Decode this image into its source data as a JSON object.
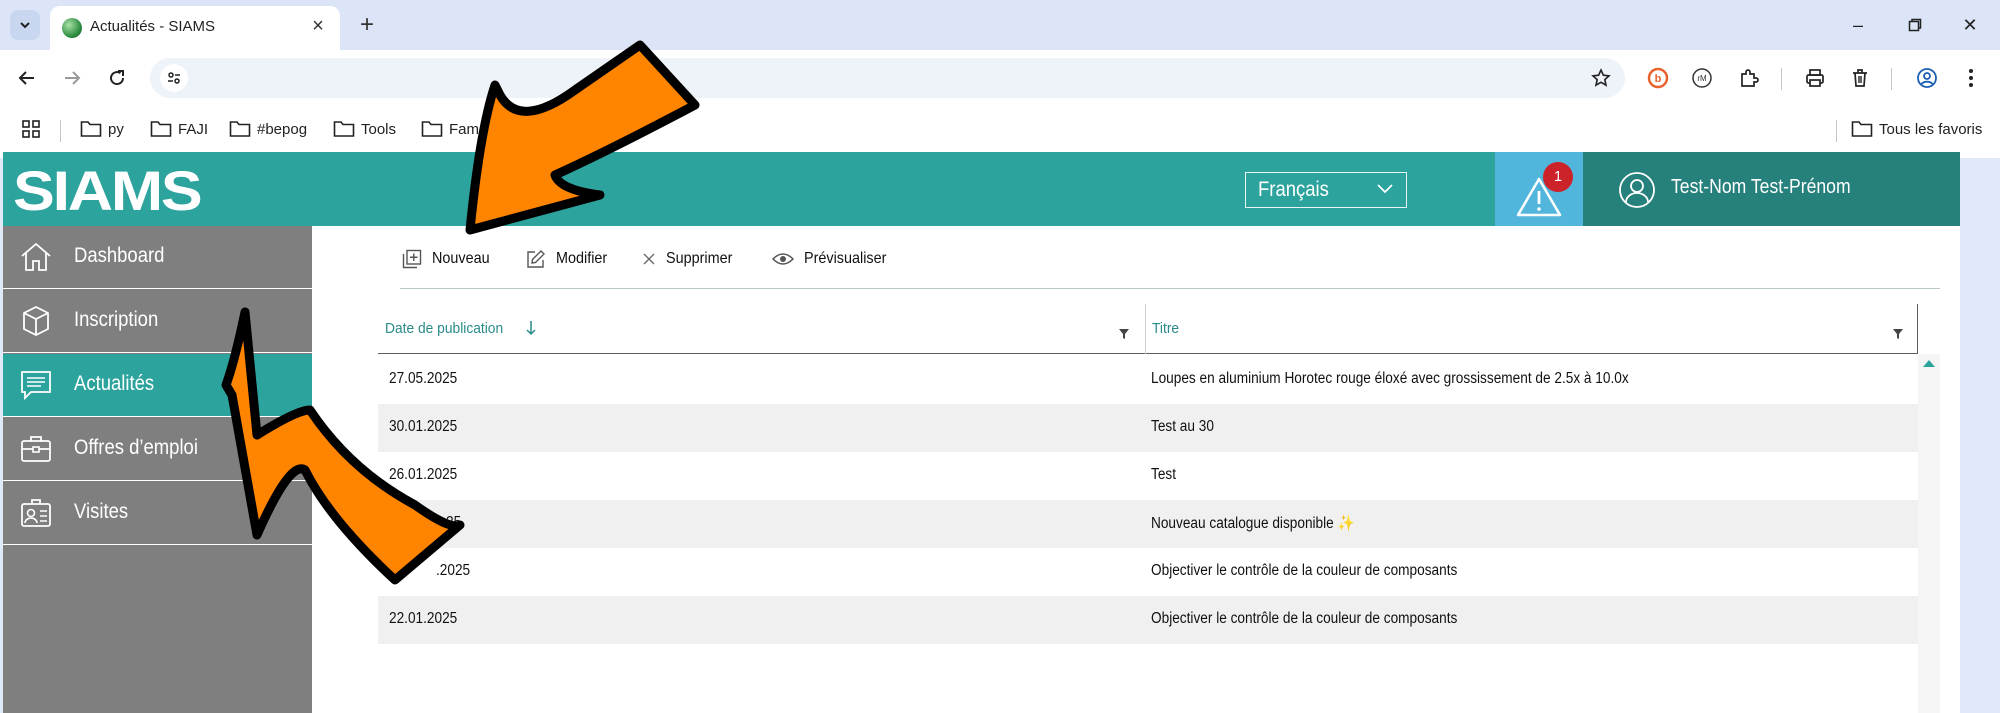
{
  "browser": {
    "tab_title": "Actualités - SIAMS",
    "bookmarks": [
      "py",
      "FAJI",
      "#bepog",
      "Tools",
      "Fam"
    ],
    "all_bookmarks": "Tous les favoris"
  },
  "header": {
    "logo": "SIAMS",
    "language": "Français",
    "alert_count": "1",
    "user_name": "Test-Nom Test-Prénom"
  },
  "sidebar": {
    "items": [
      {
        "label": "Dashboard"
      },
      {
        "label": "Inscription"
      },
      {
        "label": "Actualités"
      },
      {
        "label": "Offres d’emploi"
      },
      {
        "label": "Visites"
      }
    ]
  },
  "toolbar": {
    "new_label": "Nouveau",
    "edit_label": "Modifier",
    "delete_label": "Supprimer",
    "preview_label": "Prévisualiser"
  },
  "table": {
    "columns": [
      "Date de publication",
      "Titre"
    ],
    "rows": [
      {
        "date": "27.05.2025",
        "title": "Loupes en aluminium Horotec rouge éloxé avec grossissement de 2.5x à 10.0x"
      },
      {
        "date": "30.01.2025",
        "title": "Test au 30"
      },
      {
        "date": "26.01.2025",
        "title": "Test"
      },
      {
        "date": "25",
        "title": "Nouveau catalogue disponible ✨"
      },
      {
        "date": ".2025",
        "title": "Objectiver le contrôle de la couleur de composants"
      },
      {
        "date": "22.01.2025",
        "title": "Objectiver le contrôle de la couleur de composants"
      }
    ]
  },
  "colors": {
    "teal": "#2da39e",
    "teal_dark": "#26807c",
    "alert_blue": "#52b6dc",
    "sidebar_grey": "#7f7f7f",
    "arrow_orange": "#ff8400"
  }
}
